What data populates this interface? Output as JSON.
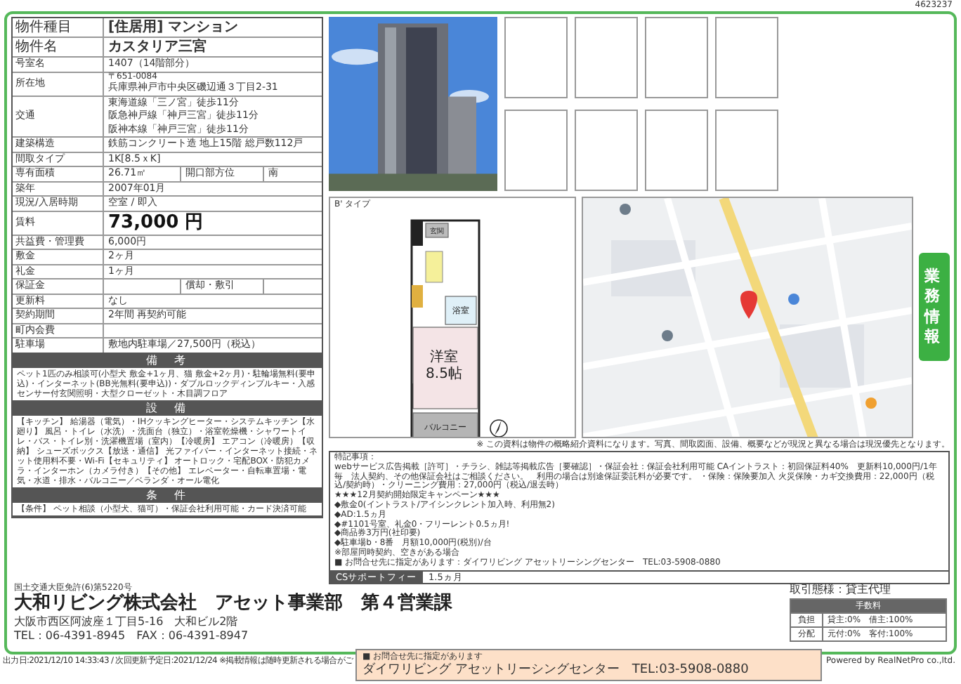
{
  "doc_id": "4623237",
  "property_table": {
    "rows": [
      {
        "label": "物件種目",
        "kind": "emph",
        "value": "[住居用] マンション"
      },
      {
        "label": "物件名",
        "kind": "emph",
        "value": "カスタリア三宮"
      },
      {
        "label": "号室名",
        "kind": "plain",
        "value": "1407（14階部分）"
      },
      {
        "label": "所在地",
        "kind": "address",
        "postal": "〒651-0084",
        "value": "兵庫県神戸市中央区磯辺通３丁目2-31"
      },
      {
        "label": "交通",
        "kind": "lines",
        "lines": [
          "東海道線「三ノ宮」徒歩11分",
          "阪急神戸線「神戸三宮」徒歩11分",
          "阪神本線「神戸三宮」徒歩11分"
        ]
      },
      {
        "label": "建築構造",
        "kind": "plain",
        "value": "鉄筋コンクリート造 地上15階 総戸数112戸"
      },
      {
        "label": "間取タイプ",
        "kind": "plain",
        "value": "1K[8.5ｘK]"
      },
      {
        "label": "専有面積",
        "kind": "split",
        "value": "26.71㎡",
        "sublabel": "開口部方位",
        "subvalue": "南"
      },
      {
        "label": "築年",
        "kind": "plain",
        "value": "2007年01月"
      },
      {
        "label": "現況/入居時期",
        "kind": "plain",
        "value": "空室 / 即入"
      },
      {
        "label": "賃料",
        "kind": "price",
        "value": "73,000 円"
      },
      {
        "label": "共益費・管理費",
        "kind": "plain",
        "value": "6,000円"
      },
      {
        "label": "敷金",
        "kind": "plain",
        "value": "2ヶ月"
      },
      {
        "label": "礼金",
        "kind": "plain",
        "value": "1ヶ月"
      },
      {
        "label": "保証金",
        "kind": "split",
        "sublabel": "償却・敷引"
      },
      {
        "label": "更新料",
        "kind": "plain",
        "value": "なし"
      },
      {
        "label": "契約期間",
        "kind": "plain",
        "value": "2年間 再契約可能"
      },
      {
        "label": "町内会費",
        "kind": "plain"
      },
      {
        "label": "駐車場",
        "kind": "plain",
        "value": "敷地内駐車場／27,500円（税込）"
      }
    ]
  },
  "sections": [
    {
      "title": "備　考",
      "text": "ペット1匹のみ相談可(小型犬 敷金+1ヶ月、猫 敷金+2ヶ月)・駐輪場無料(要申込)・インターネット(BB光無料(要申込))・ダブルロックディンプルキー・入感センサー付玄関照明・大型クローゼット・木目調フロア"
    },
    {
      "title": "設　備",
      "text": "【キッチン】 給湯器（電気）・IHクッキングヒーター・システムキッチン【水廻り】 風呂・トイレ（水洗）・洗面台（独立）・浴室乾燥機・シャワートイレ・バス・トイレ別・洗濯機置場（室内）【冷暖房】 エアコン（冷暖房）【収納】 シューズボックス【放送・通信】 光ファイバー・インターネット接続・ネット使用料不要・Wi-Fi【セキュリティ】 オートロック・宅配BOX・防犯カメラ・インターホン（カメラ付き）【その他】 エレベーター・自転車置場・電気・水道・排水・バルコニー／ベランダ・オール電化"
    },
    {
      "title": "条　件",
      "text": "【条件】 ペット相談（小型犬、猫可）・保証会社利用可能・カード決済可能"
    }
  ],
  "photos": [
    {
      "kind": "picture"
    },
    {
      "kind": "empty"
    },
    {
      "kind": "empty"
    },
    {
      "kind": "empty"
    },
    {
      "kind": "empty"
    },
    {
      "kind": "empty"
    },
    {
      "kind": "empty"
    },
    {
      "kind": "empty"
    },
    {
      "kind": "empty"
    }
  ],
  "floor_plan": {
    "type_label": "B' タイプ",
    "rooms": [
      {
        "kind": "entry",
        "name": "玄関"
      },
      {
        "kind": "bath",
        "name": "浴室"
      },
      {
        "kind": "main",
        "name": "洋室",
        "size": "8.5帖"
      },
      {
        "kind": "balcony",
        "name": "バルコニー"
      }
    ]
  },
  "map": {
    "kind": "picture"
  },
  "side_tab": {
    "label": "業務情報"
  },
  "disclaimer": "※ この資料は物件の概略紹介資料になります。写真、間取図面、設備、概要などが現況と異なる場合は現況優先となります。",
  "notes": {
    "lines": [
      "特記事項：",
      "webサービス広告掲載［許可］・チラシ、雑誌等掲載広告［要確認］・保証会社：保証会社利用可能 CAイントラスト：初回保証料40%　更新料10,000円/1年毎　法人契約、その他保証会社はご相談ください。　利用の場合は別途保証委託料が必要です。 ・保険：保険要加入 火災保険・カギ交換費用：22,000円（税込/契約時）・クリーニング費用：27,000円（税込/退去時）",
      "★★★12月契約開始限定キャンペーン★★★",
      "◆敷金0(イントラスト/アイシンクレント加入時、利用無2)",
      "◆AD:1.5ヵ月",
      "◆#1101号室、礼金0・フリーレント0.5ヵ月!",
      "◆商品券3万円(社印要)",
      "◆駐車場b・8番　月額10,000円(税別)/台",
      "※部屋同時契約、空きがある場合",
      "■ お問合せ先に指定があります：ダイワリビング アセットリーシングセンター　TEL:03-5908-0880"
    ],
    "fee_label": "CSサポートフィー",
    "fee_value": "1.5ヵ月"
  },
  "footer": {
    "license": "国土交通大臣免許(6)第5220号",
    "company": "大和リビング株式会社　アセット事業部　第４営業課",
    "address": "大阪市西区阿波座１丁目5-16　大和ビル2階",
    "tel": "TEL：06-4391-8945　FAX：06-4391-8947",
    "deal": "取引態様：貸主代理",
    "fee_title": "手数料",
    "fee_rows": [
      {
        "label": "負担",
        "value": "貸主:0%　借主:100%"
      },
      {
        "label": "分配",
        "value": "元付:0%　客付:100%"
      }
    ]
  },
  "inquiry": {
    "note": "■ お問合せ先に指定があります",
    "text": "ダイワリビング アセットリーシングセンター　TEL:03-5908-0880"
  },
  "output_line": "出力日:2021/12/10 14:33:43 / 次回更新予定日:2021/12/24 ※掲載情報は随時更新される場合がご",
  "powered": "Powered by RealNetPro co.,ltd."
}
